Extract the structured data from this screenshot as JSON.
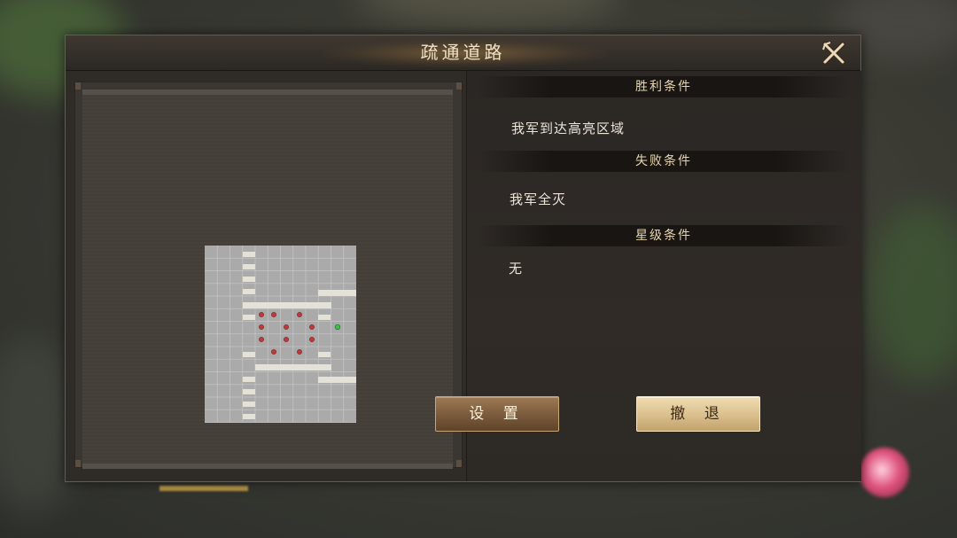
{
  "dialog": {
    "title": "疏通道路",
    "close_icon": "close-x-icon"
  },
  "conditions": {
    "victory": {
      "header": "胜利条件",
      "text": "我军到达高亮区域"
    },
    "defeat": {
      "header": "失败条件",
      "text": "我军全灭"
    },
    "star": {
      "header": "星级条件",
      "text": "无"
    }
  },
  "buttons": {
    "settings_label": "设 置",
    "retreat_label": "撤 退"
  },
  "minimap": {
    "colors": {
      "floor": "#aaaaaa",
      "grid": "#c4c4c4",
      "wall": "#e4e2d6",
      "enemy": "#c0393b",
      "ally": "#3fc04a"
    }
  }
}
